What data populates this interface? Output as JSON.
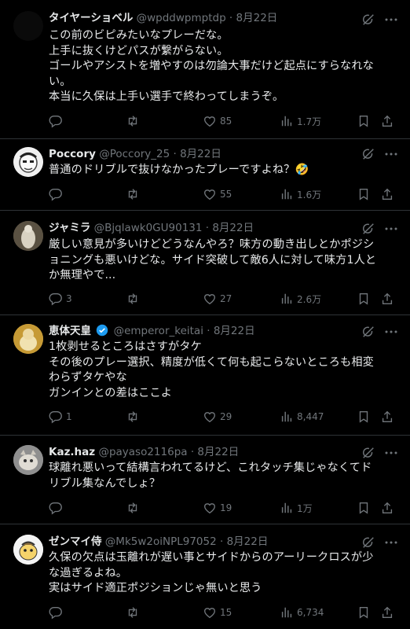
{
  "colors": {
    "background": "#000000",
    "text": "#e7e9ea",
    "muted": "#71767b",
    "divider": "#2f3336",
    "verified": "#1d9bf0"
  },
  "tweets": [
    {
      "name": "タイヤーショベル",
      "handle": "@wpddwpmptdp",
      "date": "8月22日",
      "verified": false,
      "lines": [
        "この前のビピみたいなプレーだな。",
        "上手に抜くけどパスが繋がらない。",
        "ゴールやアシストを増やすのは勿論大事だけど起点にすらなれな",
        "い。",
        "本当に久保は上手い選手で終わってしまうぞ。"
      ],
      "replies": "",
      "retweets": "",
      "likes": "85",
      "views": "1.7万"
    },
    {
      "name": "Poccory",
      "handle": "@Poccory_25",
      "date": "8月22日",
      "verified": false,
      "lines": [
        "普通のドリブルで抜けなかったプレーですよね？🤣"
      ],
      "replies": "",
      "retweets": "",
      "likes": "55",
      "views": "1.6万"
    },
    {
      "name": "ジャミラ",
      "handle": "@Bjqlawk0GU90131",
      "date": "8月22日",
      "verified": false,
      "lines": [
        "厳しい意見が多いけどどうなんやろ？味方の動き出しとかポジシ",
        "ョニングも悪いけどな。サイド突破して敵6人に対して味方1人と",
        "か無理やで..."
      ],
      "replies": "3",
      "retweets": "",
      "likes": "27",
      "views": "2.6万"
    },
    {
      "name": "恵体天皇",
      "handle": "@emperor_keitai",
      "date": "8月22日",
      "verified": true,
      "lines": [
        "1枚剥せるところはさすがタケ",
        "その後のプレー選択、精度が低くて何も起こらないところも相変",
        "わらずタケやな",
        "ガンインとの差はここよ"
      ],
      "replies": "1",
      "retweets": "",
      "likes": "29",
      "views": "8,447"
    },
    {
      "name": "Kaz.haz",
      "handle": "@payaso2116pa",
      "date": "8月22日",
      "verified": false,
      "lines": [
        "球離れ悪いって結構言われてるけど、これタッチ集じゃなくてド",
        "リブル集なんでしょ？"
      ],
      "replies": "",
      "retweets": "",
      "likes": "19",
      "views": "1万"
    },
    {
      "name": "ゼンマイ侍",
      "handle": "@Mk5w2oiNPL97052",
      "date": "8月22日",
      "verified": false,
      "lines": [
        "久保の欠点は玉離れが遅い事とサイドからのアーリークロスが少",
        "な過ぎるよね。",
        "実はサイド適正ポジションじゃ無いと思う"
      ],
      "replies": "",
      "retweets": "",
      "likes": "15",
      "views": "6,734"
    }
  ]
}
